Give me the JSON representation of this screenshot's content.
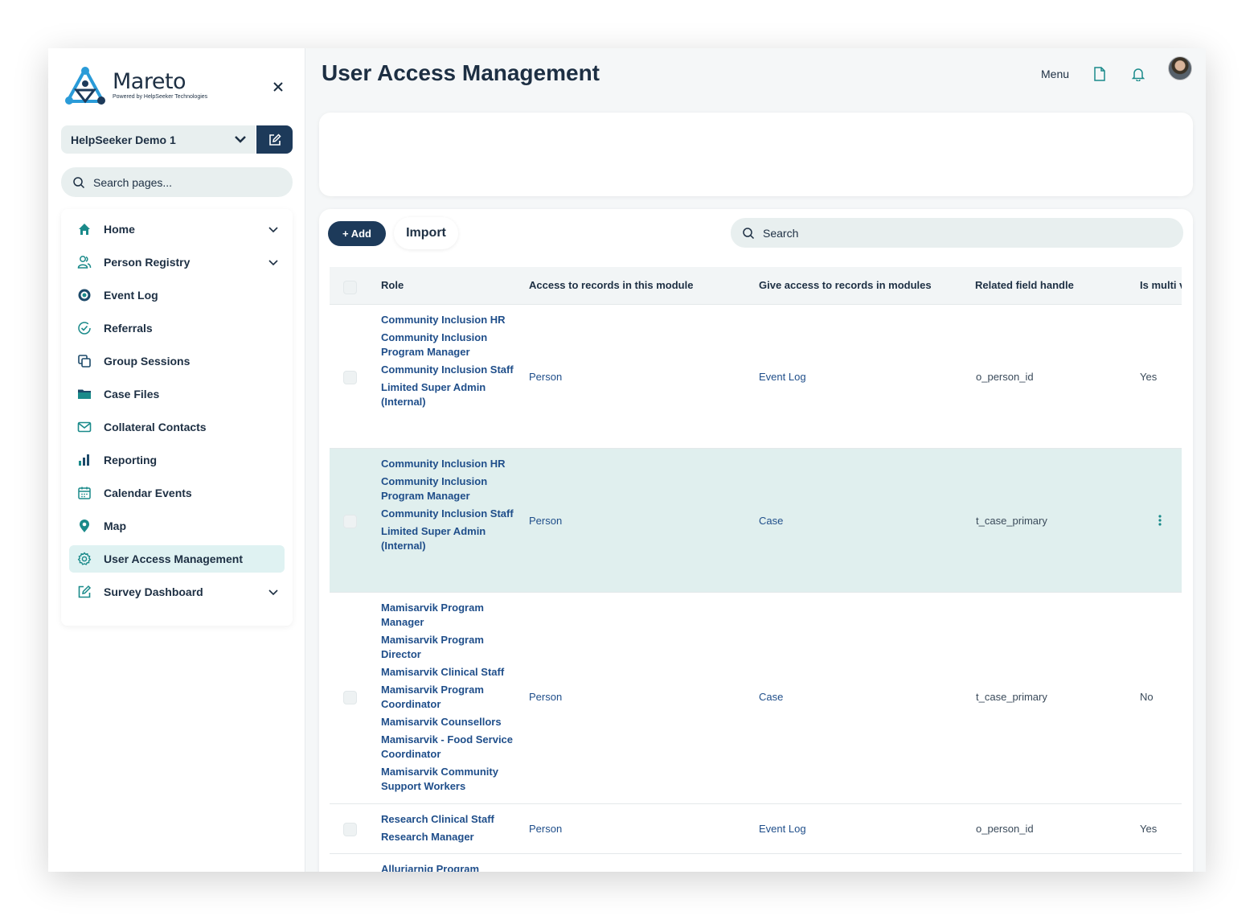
{
  "sidebar": {
    "logo": {
      "name": "Mareto",
      "tagline": "Powered by HelpSeeker Technologies"
    },
    "org": "HelpSeeker Demo 1",
    "search_placeholder": "Search pages...",
    "items": [
      {
        "label": "Home",
        "icon": "home-icon",
        "has_children": true
      },
      {
        "label": "Person Registry",
        "icon": "people-icon",
        "has_children": true
      },
      {
        "label": "Event Log",
        "icon": "target-icon",
        "has_children": false
      },
      {
        "label": "Referrals",
        "icon": "check-circle-icon",
        "has_children": false
      },
      {
        "label": "Group Sessions",
        "icon": "copy-icon",
        "has_children": false
      },
      {
        "label": "Case Files",
        "icon": "folder-icon",
        "has_children": false
      },
      {
        "label": "Collateral Contacts",
        "icon": "mail-icon",
        "has_children": false
      },
      {
        "label": "Reporting",
        "icon": "bar-chart-icon",
        "has_children": false
      },
      {
        "label": "Calendar Events",
        "icon": "calendar-icon",
        "has_children": false
      },
      {
        "label": "Map",
        "icon": "map-pin-icon",
        "has_children": false
      },
      {
        "label": "User Access Management",
        "icon": "gear-icon",
        "has_children": false,
        "active": true
      },
      {
        "label": "Survey Dashboard",
        "icon": "edit-square-icon",
        "has_children": true
      }
    ]
  },
  "header": {
    "title": "User Access Management",
    "menu_label": "Menu"
  },
  "toolbar": {
    "add_label": "+ Add",
    "import_label": "Import",
    "search_placeholder": "Search"
  },
  "table": {
    "columns": [
      "Role",
      "Access to records in this module",
      "Give access to records in modules",
      "Related field handle",
      "Is multi v"
    ],
    "rows": [
      {
        "roles": [
          "Community Inclusion HR",
          "Community Inclusion Program Manager",
          "Community Inclusion Staff",
          "Limited Super Admin (Internal)"
        ],
        "access": "Person",
        "give_access": "Event Log",
        "handle": "o_person_id",
        "multi": "Yes"
      },
      {
        "roles": [
          "Community Inclusion HR",
          "Community Inclusion Program Manager",
          "Community Inclusion Staff",
          "Limited Super Admin (Internal)"
        ],
        "access": "Person",
        "give_access": "Case",
        "handle": "t_case_primary",
        "multi": ""
      },
      {
        "roles": [
          "Mamisarvik Program Manager",
          "Mamisarvik Program Director",
          "Mamisarvik Clinical Staff",
          "Mamisarvik Program Coordinator",
          "Mamisarvik Counsellors",
          "Mamisarvik - Food Service Coordinator",
          "Mamisarvik Community Support Workers"
        ],
        "access": "Person",
        "give_access": "Case",
        "handle": "t_case_primary",
        "multi": "No"
      },
      {
        "roles": [
          "Research Clinical Staff",
          "Research Manager"
        ],
        "access": "Person",
        "give_access": "Event Log",
        "handle": "o_person_id",
        "multi": "Yes"
      },
      {
        "roles": [
          "Allurjarniq Program"
        ],
        "access": "",
        "give_access": "",
        "handle": "",
        "multi": ""
      }
    ]
  },
  "colors": {
    "accent": "#1d3a5a",
    "teal": "#1a8a8a",
    "link": "#1f4e8a",
    "highlight_row": "#e0efee"
  }
}
